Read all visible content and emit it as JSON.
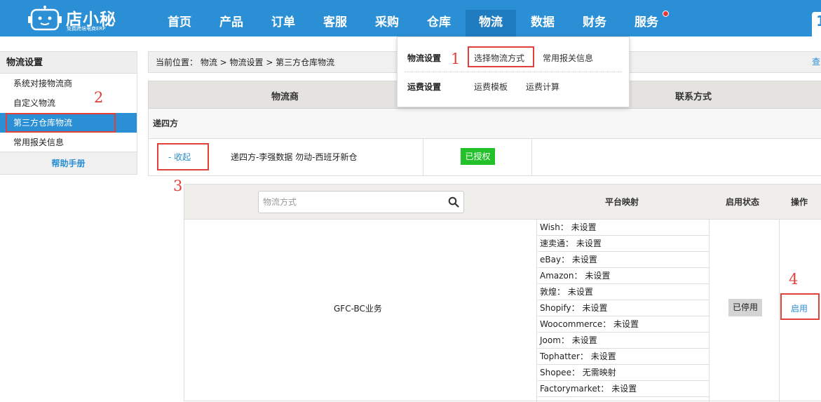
{
  "app": {
    "logo_name": "店小秘",
    "logo_sub": "免费跨境电商ERP"
  },
  "nav": {
    "items": [
      "首页",
      "产品",
      "订单",
      "客服",
      "采购",
      "仓库",
      "物流",
      "数据",
      "财务",
      "服务"
    ],
    "active": "物流",
    "top_right_char": "1"
  },
  "sidebar": {
    "title": "物流设置",
    "items": [
      "系统对接物流商",
      "自定义物流",
      "第三方仓库物流",
      "常用报关信息"
    ],
    "active_item": "第三方仓库物流",
    "help": "帮助手册"
  },
  "breadcrumb": {
    "text": "当前位置： 物流 > 物流设置 > 第三方仓库物流",
    "right_link": "查"
  },
  "table": {
    "col_carrier": "物流商",
    "col_contact": "联系方式",
    "group_name": "递四方",
    "collapse_label": "- 收起",
    "warehouse_name": "递四方-李强数据 勿动-西班牙新仓",
    "auth_status": "已授权"
  },
  "inner_table": {
    "search_placeholder": "物流方式",
    "col_mapping": "平台映射",
    "col_status": "启用状态",
    "col_action": "操作",
    "method_name": "GFC-BC业务",
    "mappings": [
      "Wish： 未设置",
      "速卖通： 未设置",
      "eBay： 未设置",
      "Amazon： 未设置",
      "敦煌： 未设置",
      "Shopify： 未设置",
      "Woocommerce： 未设置",
      "Joom： 未设置",
      "Tophatter： 未设置",
      "Shopee： 无需映射",
      "Factorymarket： 未设置"
    ],
    "status": "已停用",
    "action": "启用"
  },
  "dropdown": {
    "section1": "物流设置",
    "link1": "选择物流方式",
    "link2": "常用报关信息",
    "section2": "运费设置",
    "link3": "运费模板",
    "link4": "运费计算"
  },
  "annotations": [
    "1",
    "2",
    "3",
    "4"
  ],
  "colors": {
    "primary": "#2a8fd4",
    "annotation_red": "#e0403a",
    "authorized_green": "#22c12a"
  }
}
